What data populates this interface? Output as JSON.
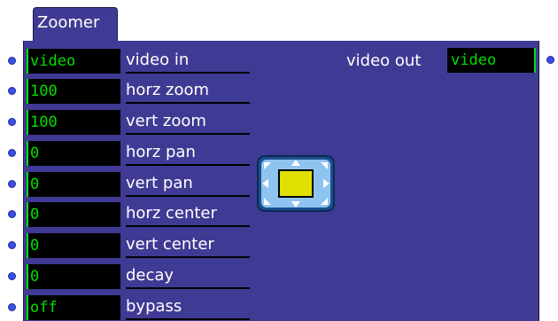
{
  "window": {
    "title": "Zoomer"
  },
  "inputs": [
    {
      "value": "video",
      "label": "video in"
    },
    {
      "value": "100",
      "label": "horz zoom"
    },
    {
      "value": "100",
      "label": "vert zoom"
    },
    {
      "value": "0",
      "label": "horz pan"
    },
    {
      "value": "0",
      "label": "vert pan"
    },
    {
      "value": "0",
      "label": "horz center"
    },
    {
      "value": "0",
      "label": "vert center"
    },
    {
      "value": "0",
      "label": "decay"
    },
    {
      "value": "off",
      "label": "bypass"
    }
  ],
  "output": {
    "label": "video out",
    "value": "video"
  },
  "icon": {
    "name": "zoom-pan-icon",
    "colors": {
      "frame": "#5aa0d8",
      "center": "#e0e000"
    }
  }
}
